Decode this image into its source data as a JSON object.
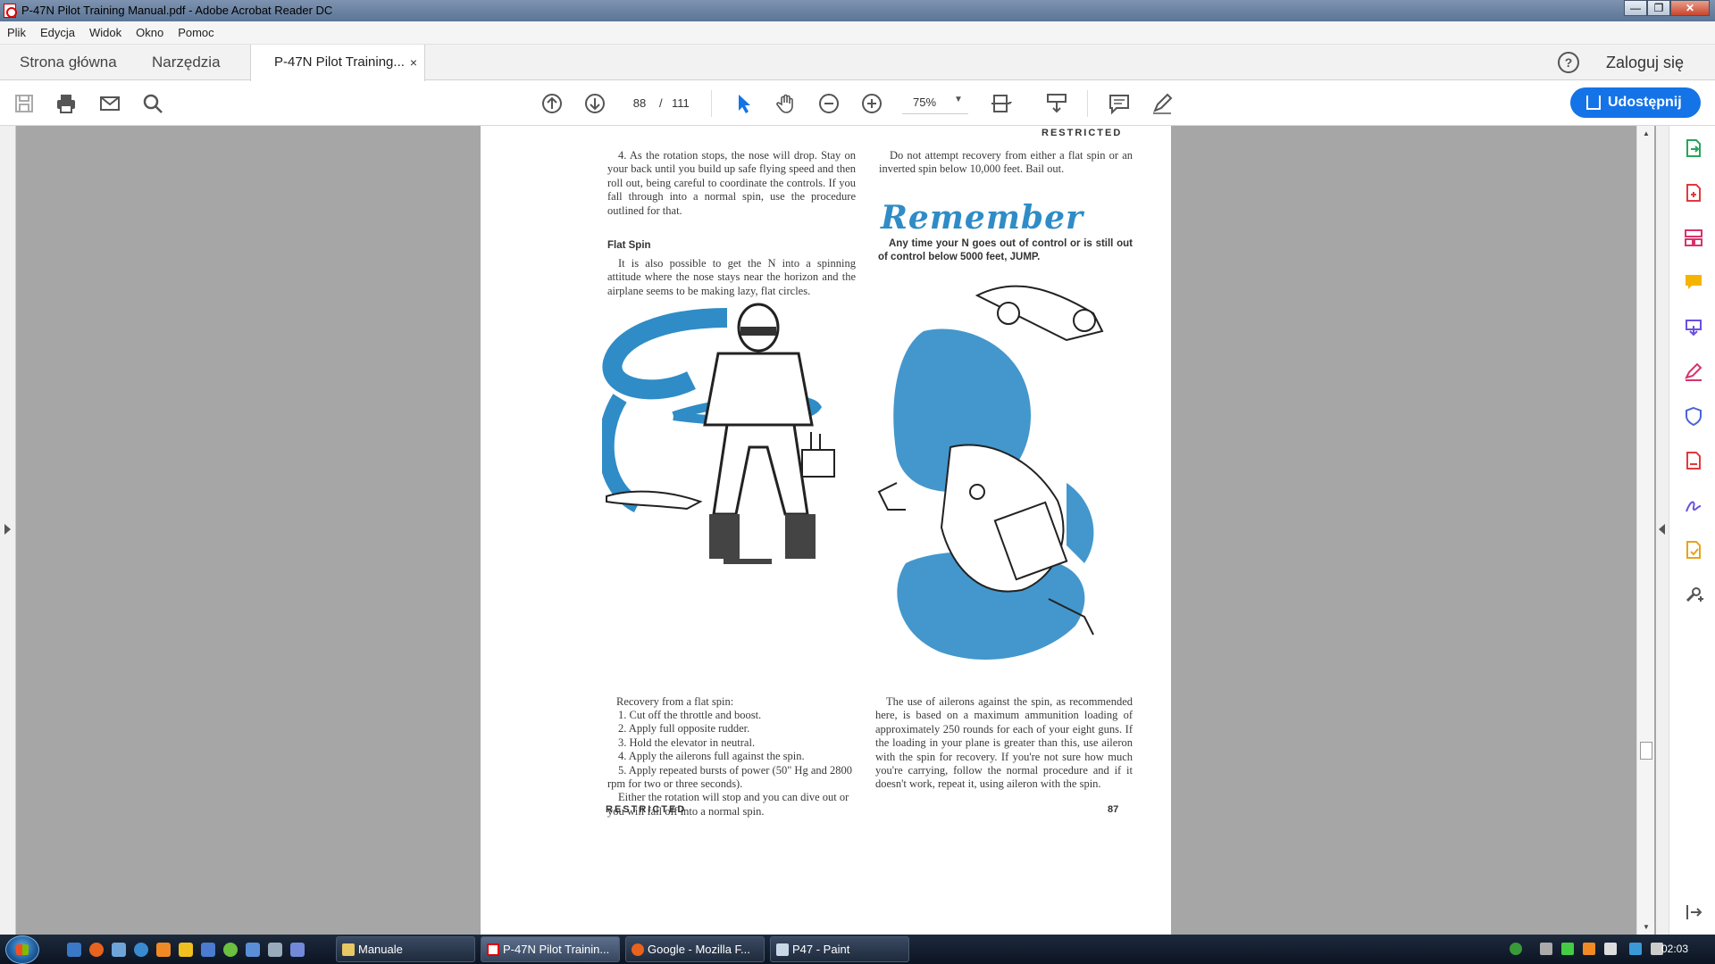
{
  "window": {
    "title": "P-47N Pilot Training Manual.pdf - Adobe Acrobat Reader DC",
    "minimize": "—",
    "maximize": "❐",
    "close": "✕"
  },
  "menu": [
    "Plik",
    "Edycja",
    "Widok",
    "Okno",
    "Pomoc"
  ],
  "tabs": {
    "home": "Strona główna",
    "tools": "Narzędzia",
    "document": "P-47N Pilot Training...",
    "close": "×"
  },
  "header": {
    "help": "?",
    "signin": "Zaloguj się"
  },
  "toolbar": {
    "page_current": "88",
    "page_separator": "/",
    "page_total": "111",
    "zoom": "75%",
    "share": "Udostępnij"
  },
  "page": {
    "header_restricted": "RESTRICTED",
    "left_top_paragraphs": [
      "4. As the rotation stops, the nose will drop. Stay on your back until you build up safe flying speed and then roll out, being careful to coordinate the controls. If you fall through into a normal spin, use the procedure outlined for that."
    ],
    "flat_spin_heading": "Flat Spin",
    "flat_spin_text": "It is also possible to get the N into a spinning attitude where the nose stays near the horizon and the airplane seems to be making lazy, flat circles.",
    "right_top_text": "Do not attempt recovery from either a flat spin or an inverted spin below 10,000 feet. Bail out.",
    "remember_heading": "Remember",
    "remember_text": "Any time your N goes out of control or is still out of control below 5000 feet, JUMP.",
    "recovery_intro": "Recovery from a flat spin:",
    "recovery_steps": [
      "1. Cut off the throttle and boost.",
      "2. Apply full opposite rudder.",
      "3. Hold the elevator in neutral.",
      "4. Apply the ailerons full against the spin.",
      "5. Apply repeated bursts of power (50\" Hg and 2800 rpm for two or three seconds).",
      "Either the rotation will stop and you can dive out or you will fall off into a normal spin."
    ],
    "ailerons_text": "The use of ailerons against the spin, as recommended here, is based on a maximum ammunition loading of approximately 250 rounds for each of your eight guns. If the loading in your plane is greater than this, use aileron with the spin for recovery. If you're not sure how much you're carrying, follow the normal procedure and if it doesn't work, repeat it, using aileron with the spin.",
    "footer_restricted": "RESTRICTED",
    "page_number": "87"
  },
  "taskbar": {
    "tasks": [
      {
        "label": "Manuale"
      },
      {
        "label": "P-47N Pilot Trainin..."
      },
      {
        "label": "Google - Mozilla F..."
      },
      {
        "label": "P47 - Paint"
      }
    ],
    "clock": "02:03"
  },
  "colors": {
    "accent": "#1473e6",
    "illustration_blue": "#2f8cc6"
  }
}
